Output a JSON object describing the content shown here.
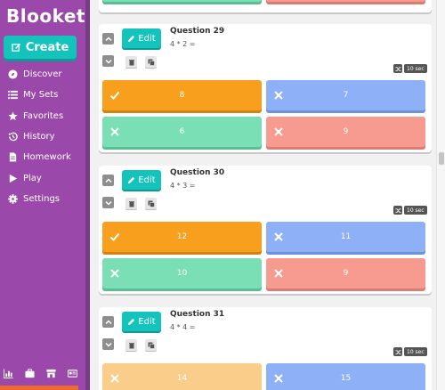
{
  "app": {
    "logo": "Blooket"
  },
  "sidebar": {
    "create_label": "Create",
    "items": [
      {
        "label": "Discover",
        "icon": "compass-icon"
      },
      {
        "label": "My Sets",
        "icon": "list-icon"
      },
      {
        "label": "Favorites",
        "icon": "star-icon"
      },
      {
        "label": "History",
        "icon": "history-icon"
      },
      {
        "label": "Homework",
        "icon": "document-icon"
      },
      {
        "label": "Play",
        "icon": "play-icon"
      },
      {
        "label": "Settings",
        "icon": "gear-icon"
      }
    ],
    "bottom_icons": [
      "stats-icon",
      "briefcase-icon",
      "store-icon",
      "newspaper-icon"
    ]
  },
  "questions": [
    {
      "title": "Question 29",
      "text": "4 * 2 =",
      "time": "10 sec",
      "edit_label": "Edit",
      "answers": [
        {
          "value": "8",
          "correct": true,
          "color": "orange"
        },
        {
          "value": "7",
          "correct": false,
          "color": "blue"
        },
        {
          "value": "6",
          "correct": false,
          "color": "green"
        },
        {
          "value": "9",
          "correct": false,
          "color": "red"
        }
      ]
    },
    {
      "title": "Question 30",
      "text": "4 * 3 =",
      "time": "10 sec",
      "edit_label": "Edit",
      "answers": [
        {
          "value": "12",
          "correct": true,
          "color": "orange"
        },
        {
          "value": "11",
          "correct": false,
          "color": "blue"
        },
        {
          "value": "10",
          "correct": false,
          "color": "green"
        },
        {
          "value": "9",
          "correct": false,
          "color": "red"
        }
      ]
    },
    {
      "title": "Question 31",
      "text": "4 * 4 =",
      "time": "10 sec",
      "edit_label": "Edit",
      "answers": [
        {
          "value": "14",
          "correct": false,
          "color": "light-orange"
        },
        {
          "value": "15",
          "correct": false,
          "color": "blue"
        }
      ]
    }
  ],
  "colors": {
    "sidebar": "#9a49aa",
    "accent": "#14c3bb",
    "orange": "#f8a01e",
    "blue": "#8db0f6",
    "green": "#7adfb4",
    "red": "#f79b90"
  }
}
